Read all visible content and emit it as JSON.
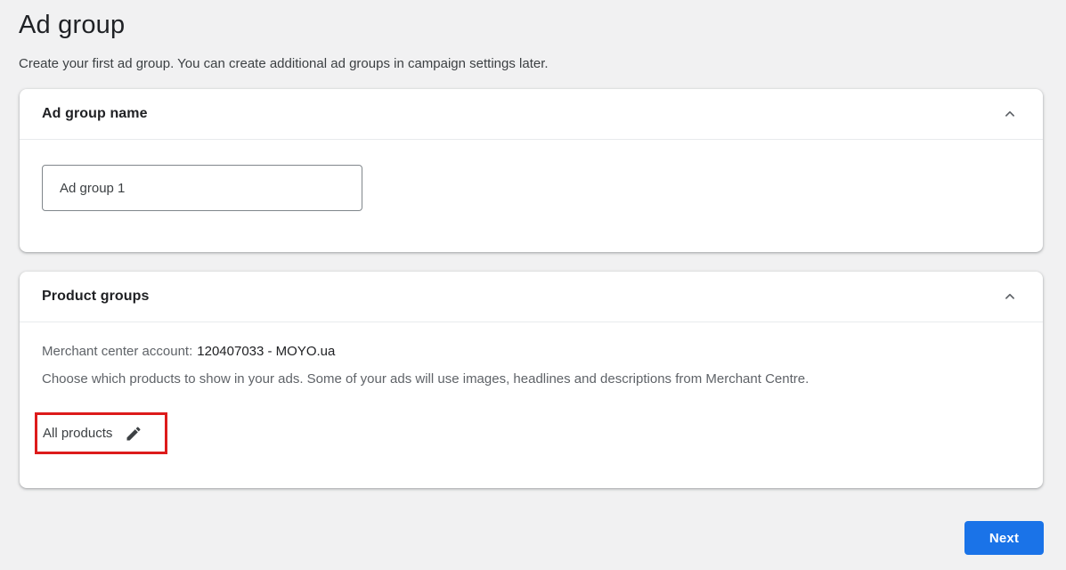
{
  "page": {
    "title": "Ad group",
    "subtitle": "Create your first ad group. You can create additional ad groups in campaign settings later."
  },
  "ad_group_name_card": {
    "title": "Ad group name",
    "input_value": "Ad group 1",
    "collapse_icon": "chevron-up-icon"
  },
  "product_groups_card": {
    "title": "Product groups",
    "merchant_label": "Merchant center account:",
    "merchant_value": "120407033 - MOYO.ua",
    "description": "Choose which products to show in your ads. Some of your ads will use images, headlines and descriptions from Merchant Centre.",
    "selection_label": "All products",
    "edit_icon": "pencil-icon",
    "collapse_icon": "chevron-up-icon"
  },
  "footer": {
    "next_label": "Next"
  },
  "colors": {
    "accent_blue": "#1a73e8",
    "annotation_red": "#dd1b1b",
    "background": "#f1f1f2",
    "card_background": "#ffffff",
    "text_primary": "#202124",
    "text_secondary": "#5f6368",
    "divider": "#e8eaed",
    "input_border": "#80868b"
  }
}
